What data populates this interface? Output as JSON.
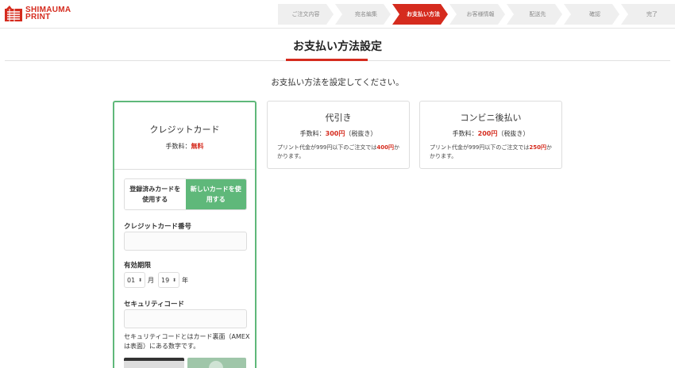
{
  "brand": {
    "line1": "SHIMAUMA",
    "line2": "PRINT",
    "color": "#d52b1e"
  },
  "steps": [
    {
      "label": "ご注文内容",
      "active": false
    },
    {
      "label": "宛名編集",
      "active": false
    },
    {
      "label": "お支払い方法",
      "active": true
    },
    {
      "label": "お客様情報",
      "active": false
    },
    {
      "label": "配送先",
      "active": false
    },
    {
      "label": "確認",
      "active": false
    },
    {
      "label": "完了",
      "active": false
    }
  ],
  "page": {
    "title": "お支払い方法設定",
    "subtitle": "お支払い方法を設定してください。"
  },
  "credit": {
    "title": "クレジットカード",
    "fee_label": "手数料：",
    "fee_value": "無料",
    "toggle_saved": "登録済みカードを使用する",
    "toggle_new": "新しいカードを使用する",
    "card_number_label": "クレジットカード番号",
    "card_number_value": "",
    "expiry_label": "有効期限",
    "expiry_month": "01",
    "expiry_month_unit": "月",
    "expiry_year": "19",
    "expiry_year_unit": "年",
    "security_label": "セキュリティコード",
    "security_value": "",
    "security_help": "セキュリティコードとはカード裏面（AMEXは表面）にある数字です。"
  },
  "cod": {
    "title": "代引き",
    "fee_label": "手数料：",
    "fee_value": "300円",
    "fee_suffix": "（税抜き）",
    "note_pre": "プリント代金が999円以下のご注文では",
    "note_value": "400円",
    "note_post": "かかります。"
  },
  "convenience": {
    "title": "コンビニ後払い",
    "fee_label": "手数料：",
    "fee_value": "200円",
    "fee_suffix": "（税抜き）",
    "note_pre": "プリント代金が999円以下のご注文では",
    "note_value": "250円",
    "note_post": "かかります。"
  },
  "colors": {
    "accent": "#d52b1e",
    "selected": "#5fb87a"
  }
}
